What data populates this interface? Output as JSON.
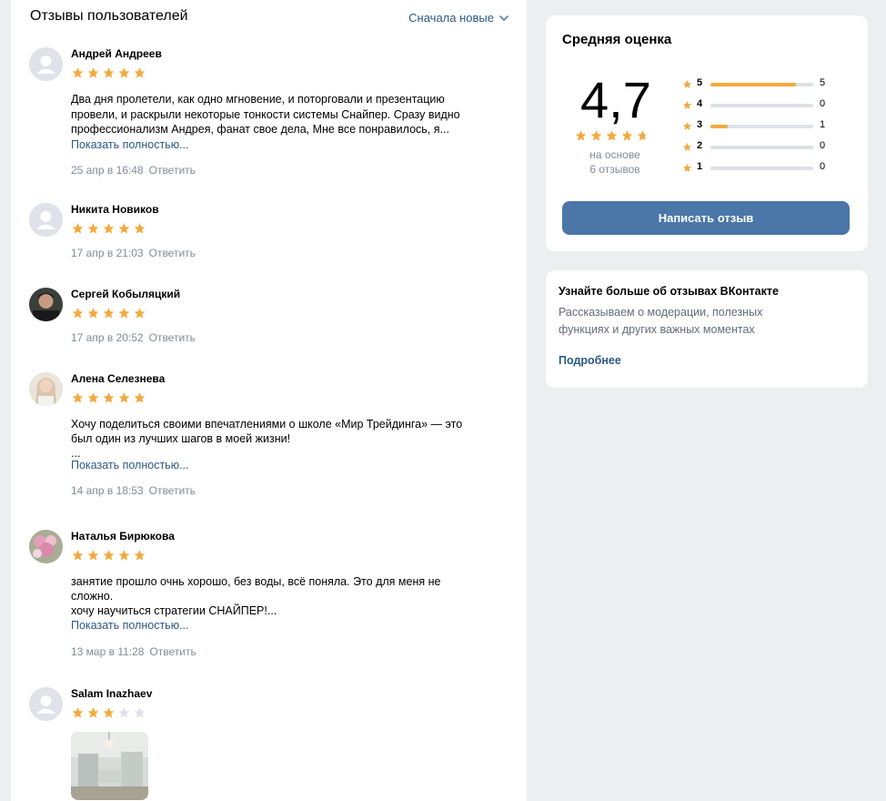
{
  "reviews_section": {
    "title": "Отзывы пользователей",
    "sort_label": "Сначала новые",
    "more_label": "Показать полностью...",
    "reply_label": "Ответить"
  },
  "reviews": [
    {
      "name": "Андрей Андреев",
      "rating": 5,
      "text": "Два дня пролетели, как одно мгновение, и поторговали и презентацию\nпровели, и раскрыли некоторые тонкости системы Снайпер. Сразу видно\nпрофессионализм Андрея, фанат свое дела, Мне все понравилось, я...",
      "date": "25 апр в 16:48",
      "avatar": "default"
    },
    {
      "name": "Никита Новиков",
      "rating": 5,
      "text": "",
      "date": "17 апр в 21:03",
      "avatar": "default"
    },
    {
      "name": "Сергей Кобыляцкий",
      "rating": 5,
      "text": "",
      "date": "17 апр в 20:52",
      "avatar": "photo-man"
    },
    {
      "name": "Алена Селезнева",
      "rating": 5,
      "text": "Хочу поделиться своими впечатлениями о школе «Мир Трейдинга» — это\nбыл один из лучших шагов в моей жизни!\n...",
      "date": "14 апр в 18:53",
      "avatar": "photo-woman"
    },
    {
      "name": "Наталья Бирюкова",
      "rating": 5,
      "text": "занятие прошло очнь хорошо, без воды, всё поняла. Это для меня не\nсложно.\nхочу научиться стратегии СНАЙПЕР!...",
      "date": "13 мар в 11:28",
      "avatar": "photo-flowers"
    },
    {
      "name": "Salam Inazhaev",
      "rating": 3,
      "text": "",
      "date": "",
      "avatar": "default"
    }
  ],
  "rating_summary": {
    "title": "Средняя оценка",
    "average": "4,7",
    "average_stars": 4.7,
    "based_on": "на основе\n6 отзывов",
    "distribution": [
      {
        "stars": "5",
        "count": "5",
        "fraction": 0.83
      },
      {
        "stars": "4",
        "count": "0",
        "fraction": 0
      },
      {
        "stars": "3",
        "count": "1",
        "fraction": 0.17
      },
      {
        "stars": "2",
        "count": "0",
        "fraction": 0
      },
      {
        "stars": "1",
        "count": "0",
        "fraction": 0
      }
    ],
    "write_button": "Написать отзыв"
  },
  "info": {
    "title": "Узнайте больше об отзывах ВКонтакте",
    "text": "Рассказываем о модерации, полезных\nфункциях и других важных моментах",
    "link": "Подробнее"
  },
  "colors": {
    "accent": "#4a76a8",
    "link": "#2a5885",
    "star": "#f3a93c",
    "star_empty": "#dce1e6"
  },
  "icons": {
    "sort": "chevron-down-icon",
    "star": "star-icon",
    "avatar_default": "user-icon"
  }
}
